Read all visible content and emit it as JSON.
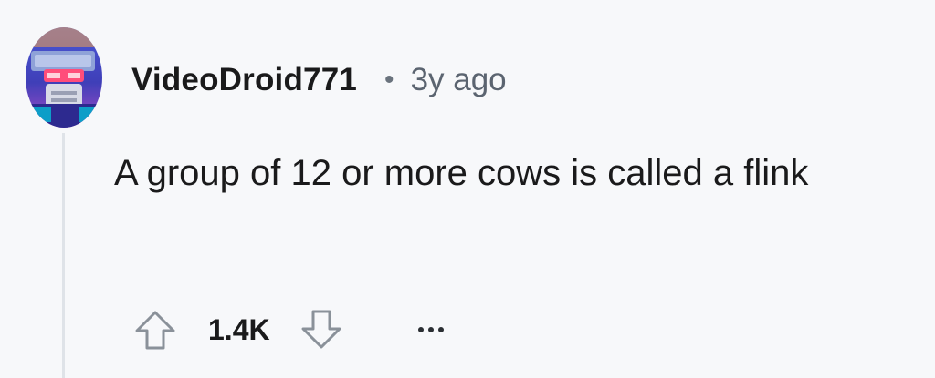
{
  "comment": {
    "username": "VideoDroid771",
    "separator": "•",
    "timestamp": "3y ago",
    "body": "A group of 12 or more cows is called a flink",
    "score": "1.4K"
  },
  "icons": {
    "avatar": "robot-avatar-icon",
    "upvote": "arrow-up-outline-icon",
    "downvote": "arrow-down-outline-icon",
    "more": "more-horizontal-icon"
  },
  "colors": {
    "background": "#f7f8fa",
    "text": "#1a1a1b",
    "muted": "#5b6470",
    "thread_line": "#dfe3e8",
    "icon_stroke": "#8a9199"
  }
}
